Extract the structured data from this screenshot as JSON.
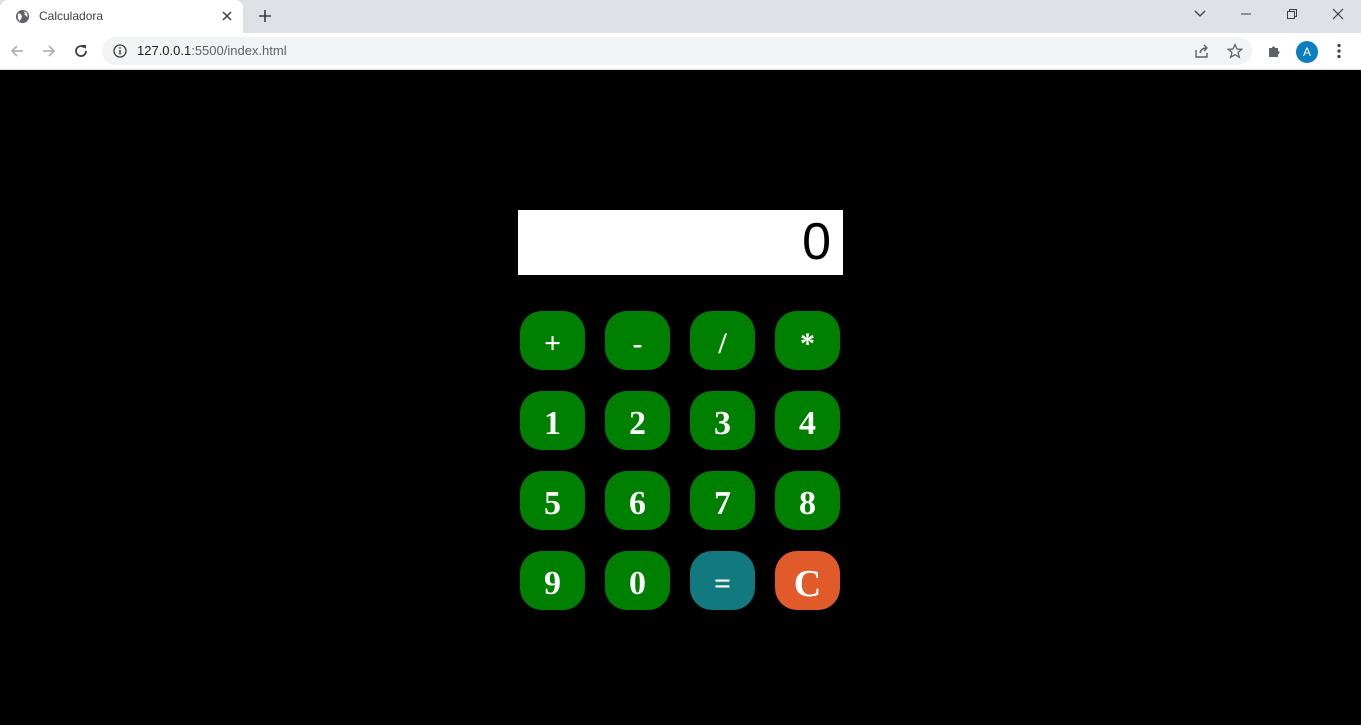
{
  "browser": {
    "tab": {
      "title": "Calculadora"
    },
    "address": {
      "host": "127.0.0.1",
      "rest": ":5500/index.html"
    },
    "profile_initial": "A"
  },
  "calculator": {
    "display_value": "0",
    "keys": {
      "plus": "+",
      "minus": "-",
      "divide": "/",
      "multiply": "*",
      "k1": "1",
      "k2": "2",
      "k3": "3",
      "k4": "4",
      "k5": "5",
      "k6": "6",
      "k7": "7",
      "k8": "8",
      "k9": "9",
      "k0": "0",
      "equals": "=",
      "clear": "C"
    },
    "colors": {
      "digit_key": "#008000",
      "equals_key": "#12797f",
      "clear_key": "#e05a2a",
      "background": "#000000",
      "display_bg": "#ffffff"
    }
  }
}
